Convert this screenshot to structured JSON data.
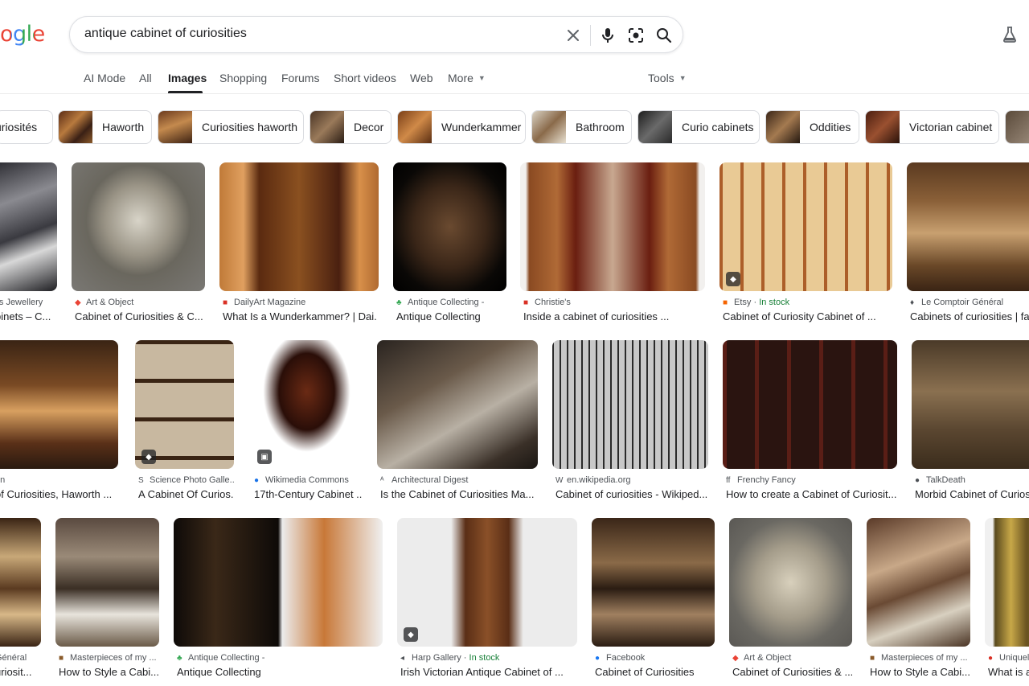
{
  "logo": {
    "text": "ogle",
    "colors": [
      "#ea4335",
      "#4285f4",
      "#34a853",
      "#ea4335"
    ]
  },
  "search": {
    "query": "antique cabinet of curiosities",
    "icons": [
      "close-icon",
      "microphone-icon",
      "lens-icon",
      "search-icon"
    ]
  },
  "header": {
    "labs_icon": "flask-icon"
  },
  "tabs": [
    {
      "label": "AI Mode"
    },
    {
      "label": "All"
    },
    {
      "label": "Images",
      "active": true
    },
    {
      "label": "Shopping"
    },
    {
      "label": "Forums"
    },
    {
      "label": "Short videos"
    },
    {
      "label": "Web"
    },
    {
      "label": "More"
    },
    {
      "label": "Tools"
    }
  ],
  "chips": [
    {
      "label": "uriosités"
    },
    {
      "label": "Haworth"
    },
    {
      "label": "Curiosities haworth"
    },
    {
      "label": "Decor"
    },
    {
      "label": "Wunderkammer"
    },
    {
      "label": "Bathroom"
    },
    {
      "label": "Curio cabinets"
    },
    {
      "label": "Oddities"
    },
    {
      "label": "Victorian cabinet"
    }
  ],
  "results": [
    {
      "source": "lls Jewellery",
      "title": "binets – C...",
      "fav": ""
    },
    {
      "source": "Art & Object",
      "title": "Cabinet of Curiosities & C...",
      "fav": "◆"
    },
    {
      "source": "DailyArt Magazine",
      "title": "What Is a Wunderkammer? | Dai...",
      "fav": "■"
    },
    {
      "source": "Antique Collecting -",
      "title": "Antique Collecting",
      "fav": "♣"
    },
    {
      "source": "Christie's",
      "title": "Inside a cabinet of curiosities ...",
      "fav": "■"
    },
    {
      "source": "Etsy",
      "stock": "In stock",
      "title": "Cabinet of Curiosity Cabinet of ...",
      "fav": "■"
    },
    {
      "source": "Le Comptoir Général",
      "title": "Cabinets of curiosities | fa",
      "fav": "♦"
    },
    {
      "source": "on",
      "title": "of Curiosities, Haworth ...",
      "fav": ""
    },
    {
      "source": "Science Photo Galle...",
      "title": "A Cabinet Of Curios...",
      "fav": "S"
    },
    {
      "source": "Wikimedia Commons",
      "title": "17th-Century Cabinet ...",
      "fav": "●"
    },
    {
      "source": "Architectural Digest",
      "title": "Is the Cabinet of Curiosities Ma...",
      "fav": "ᴬ"
    },
    {
      "source": "en.wikipedia.org",
      "title": "Cabinet of curiosities - Wikiped...",
      "fav": "W"
    },
    {
      "source": "Frenchy Fancy",
      "title": "How to create a Cabinet of Curiosit...",
      "fav": "ff"
    },
    {
      "source": "TalkDeath",
      "title": "Morbid Cabinet of Curios",
      "fav": "●"
    },
    {
      "source": "Général",
      "title": "uriosit...",
      "fav": ""
    },
    {
      "source": "Masterpieces of my ...",
      "title": "How to Style a Cabi...",
      "fav": "■"
    },
    {
      "source": "Antique Collecting -",
      "title": "Antique Collecting",
      "fav": "♣"
    },
    {
      "source": "Harp Gallery",
      "stock": "In stock",
      "title": "Irish Victorian Antique Cabinet of ...",
      "fav": "◂"
    },
    {
      "source": "Facebook",
      "title": "Cabinet of Curiosities",
      "fav": "●"
    },
    {
      "source": "Art & Object",
      "title": "Cabinet of Curiosities & ...",
      "fav": "◆"
    },
    {
      "source": "Masterpieces of my ...",
      "title": "How to Style a Cabi...",
      "fav": "■"
    },
    {
      "source": "Uniquel",
      "title": "What is a",
      "fav": "●"
    }
  ],
  "separator": " · "
}
